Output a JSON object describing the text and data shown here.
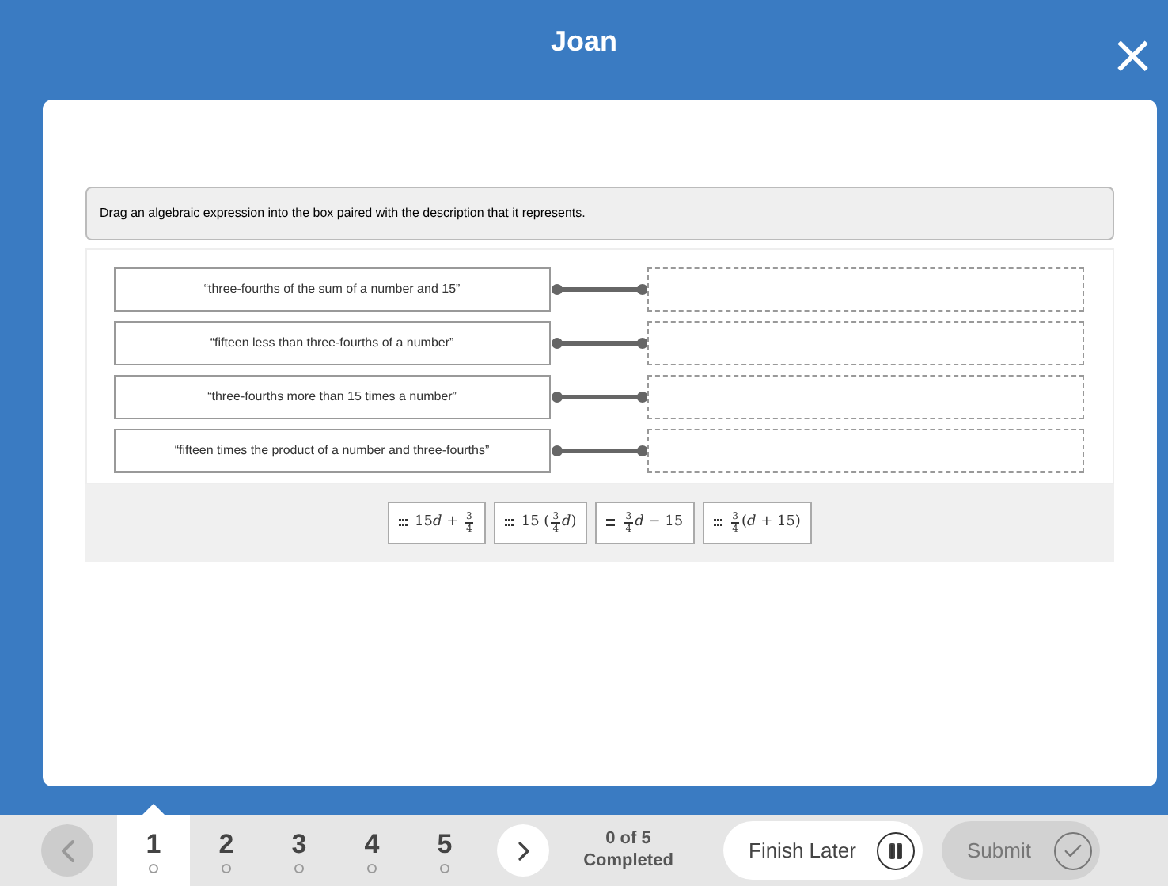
{
  "header": {
    "title": "Joan",
    "close": "×"
  },
  "instruction": "Drag an algebraic expression into the box paired with the description that it represents.",
  "descriptions": [
    {
      "text": "“three-fourths of the sum of a number and 15”"
    },
    {
      "text": "“fifteen less than three-fourths of a number”"
    },
    {
      "text": "“three-fourths more than 15 times a number”"
    },
    {
      "text": "“fifteen times the product of a number and three-fourths”"
    }
  ],
  "tiles": [
    {
      "parts": [
        {
          "kind": "text",
          "text": "15"
        },
        {
          "kind": "var",
          "text": "d"
        },
        {
          "kind": "text",
          "text": " + "
        },
        {
          "kind": "frac",
          "num": "3",
          "den": "4"
        }
      ]
    },
    {
      "parts": [
        {
          "kind": "text",
          "text": "15 ("
        },
        {
          "kind": "frac",
          "num": "3",
          "den": "4"
        },
        {
          "kind": "var",
          "text": "d"
        },
        {
          "kind": "text",
          "text": ")"
        }
      ]
    },
    {
      "parts": [
        {
          "kind": "frac",
          "num": "3",
          "den": "4"
        },
        {
          "kind": "var",
          "text": "d"
        },
        {
          "kind": "text",
          "text": " − 15"
        }
      ]
    },
    {
      "parts": [
        {
          "kind": "frac",
          "num": "3",
          "den": "4"
        },
        {
          "kind": "text",
          "text": "("
        },
        {
          "kind": "var",
          "text": "d"
        },
        {
          "kind": "text",
          "text": " + 15)"
        }
      ]
    }
  ],
  "footer": {
    "prev_disabled": true,
    "next_disabled": false,
    "questions": [
      {
        "label": "1",
        "selected": true
      },
      {
        "label": "2",
        "selected": false
      },
      {
        "label": "3",
        "selected": false
      },
      {
        "label": "4",
        "selected": false
      },
      {
        "label": "5",
        "selected": false
      }
    ],
    "progress": [
      "0 of 5",
      "Completed"
    ],
    "finish_later": "Finish Later",
    "submit": "Submit",
    "submit_disabled": true
  }
}
